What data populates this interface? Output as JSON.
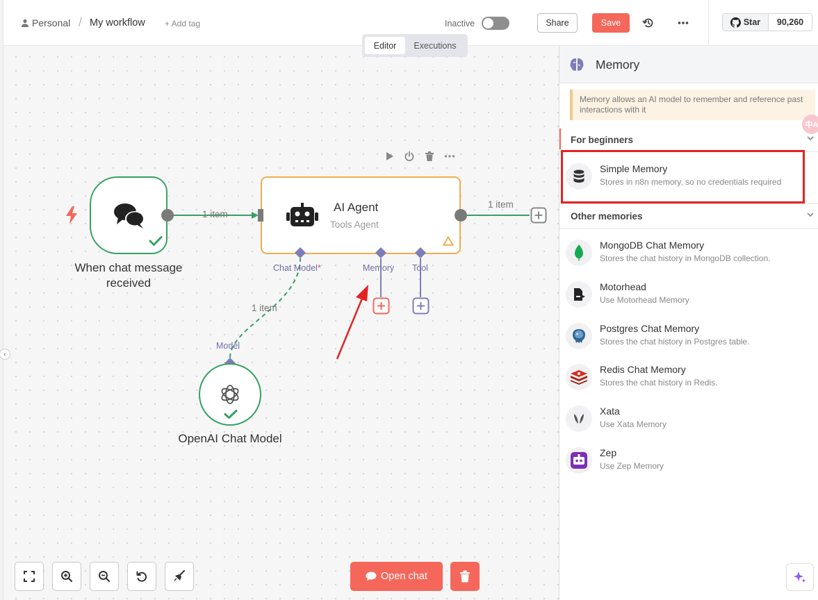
{
  "header": {
    "breadcrumb_personal": "Personal",
    "breadcrumb_sep": "/",
    "breadcrumb_workflow": "My workflow",
    "add_tag": "+ Add tag",
    "status_label": "Inactive",
    "share_label": "Share",
    "save_label": "Save",
    "star_label": "Star",
    "star_count": "90,260"
  },
  "tabs": [
    {
      "label": "Editor",
      "active": true
    },
    {
      "label": "Executions",
      "active": false
    }
  ],
  "canvas": {
    "nodes": {
      "chat_trigger": {
        "label": "When chat message received"
      },
      "agent": {
        "title": "AI Agent",
        "subtitle": "Tools Agent"
      },
      "openai": {
        "label": "OpenAI Chat Model"
      }
    },
    "edges": {
      "trigger_to_agent": "1 item",
      "agent_out": "1 item",
      "model_to_agent": "1 item"
    },
    "ports": {
      "chat_model": "Chat Model",
      "chat_model_required": "*",
      "memory": "Memory",
      "tool": "Tool",
      "model": "Model"
    },
    "open_chat_label": "Open chat"
  },
  "panel": {
    "title": "Memory",
    "callout": "Memory allows an AI model to remember and reference past interactions with it",
    "translate_badge": "中A",
    "section_beginners": "For beginners",
    "beginners_items": [
      {
        "name": "Simple Memory",
        "desc": "Stores in n8n memory, so no credentials required",
        "icon": "database-icon"
      }
    ],
    "section_other": "Other memories",
    "other_items": [
      {
        "name": "MongoDB Chat Memory",
        "desc": "Stores the chat history in MongoDB collection.",
        "icon": "mongodb-icon"
      },
      {
        "name": "Motorhead",
        "desc": "Use Motorhead Memory",
        "icon": "motorhead-icon"
      },
      {
        "name": "Postgres Chat Memory",
        "desc": "Stores the chat history in Postgres table.",
        "icon": "postgres-icon"
      },
      {
        "name": "Redis Chat Memory",
        "desc": "Stores the chat history in Redis.",
        "icon": "redis-icon"
      },
      {
        "name": "Xata",
        "desc": "Use Xata Memory",
        "icon": "xata-icon"
      },
      {
        "name": "Zep",
        "desc": "Use Zep Memory",
        "icon": "zep-icon"
      }
    ]
  },
  "colors": {
    "accent": "#f4675a",
    "success": "#35a163",
    "warning": "#f0ad4e",
    "port": "#7d7db8"
  }
}
